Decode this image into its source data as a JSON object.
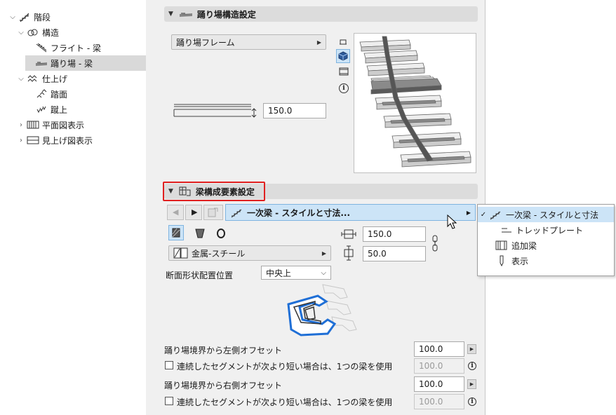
{
  "tree": {
    "items": [
      {
        "label": "階段",
        "chev": "v"
      },
      {
        "label": "構造",
        "chev": "v"
      },
      {
        "label": "フライト - 梁",
        "chev": ""
      },
      {
        "label": "踊り場 - 梁",
        "chev": ""
      },
      {
        "label": "仕上げ",
        "chev": "v"
      },
      {
        "label": "踏面",
        "chev": ""
      },
      {
        "label": "蹴上",
        "chev": ""
      },
      {
        "label": "平面図表示",
        "chev": ">"
      },
      {
        "label": "見上げ図表示",
        "chev": ">"
      }
    ]
  },
  "section1": {
    "title": "踊り場構造設定",
    "frame_popup": "踊り場フレーム",
    "thickness": "150.0"
  },
  "section2": {
    "title": "梁構成要素設定",
    "nav_popup": "一次梁 - スタイルと寸法...",
    "material_popup": "金属-スチール",
    "width": "150.0",
    "height": "50.0",
    "profile_position_label": "断面形状配置位置",
    "profile_position_value": "中央上",
    "left_offset_label": "踊り場境界から左側オフセット",
    "left_offset_value": "100.0",
    "left_check_label": "連続したセグメントが次より短い場合は、1つの梁を使用",
    "left_check_value": "100.0",
    "right_offset_label": "踊り場境界から右側オフセット",
    "right_offset_value": "100.0",
    "right_check_label": "連続したセグメントが次より短い場合は、1つの梁を使用",
    "right_check_value": "100.0"
  },
  "menu": {
    "items": [
      {
        "label": "一次梁 - スタイルと寸法",
        "checked": true
      },
      {
        "label": "トレッドプレート",
        "checked": false
      },
      {
        "label": "追加梁",
        "checked": false
      },
      {
        "label": "表示",
        "checked": false
      }
    ]
  },
  "colors": {
    "highlight_border": "#e02020",
    "selection_blue": "#cce4f7",
    "accent_blue": "#1f6fd6"
  }
}
